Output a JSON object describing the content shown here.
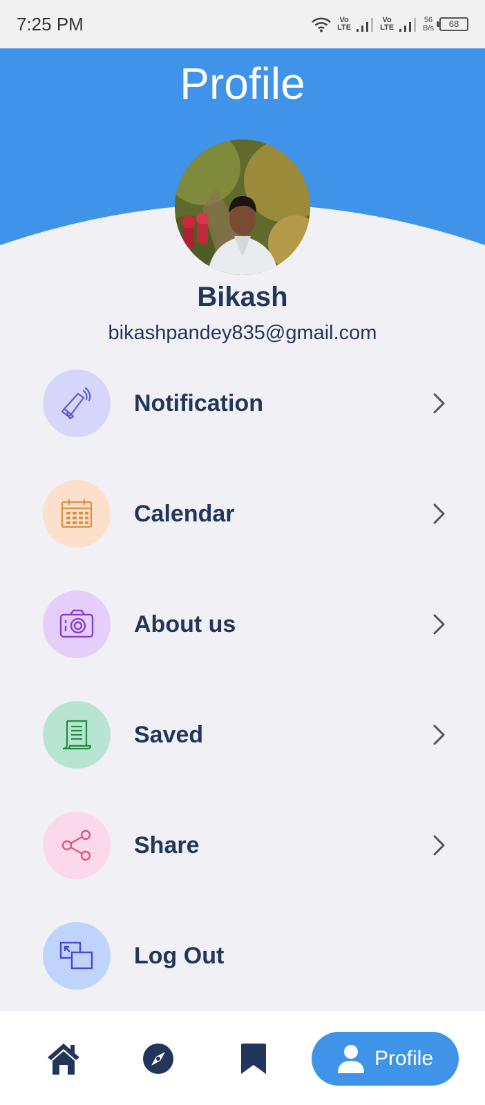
{
  "status_bar": {
    "time": "7:25 PM",
    "sim1": [
      "Vo",
      "LTE"
    ],
    "sim2": [
      "Vo",
      "LTE"
    ],
    "speed": [
      "56",
      "B/s"
    ],
    "battery": "68"
  },
  "header": {
    "title": "Profile",
    "color": "#3f93e8"
  },
  "user": {
    "name": "Bikash",
    "email": "bikashpandey835@gmail.com"
  },
  "menu": [
    {
      "label": "Notification",
      "icon": "megaphone-icon",
      "bg": "#d6d6fb",
      "stroke": "#5b5bd6",
      "has_chevron": true
    },
    {
      "label": "Calendar",
      "icon": "calendar-icon",
      "bg": "#fde0cb",
      "stroke": "#d99043",
      "has_chevron": true
    },
    {
      "label": "About us",
      "icon": "camera-icon",
      "bg": "#e5cef9",
      "stroke": "#8a3ed0",
      "has_chevron": true
    },
    {
      "label": "Saved",
      "icon": "scroll-icon",
      "bg": "#b8e5d2",
      "stroke": "#1f8d3e",
      "has_chevron": true
    },
    {
      "label": "Share",
      "icon": "share-icon",
      "bg": "#fcd9ea",
      "stroke": "#e0557f",
      "has_chevron": true
    },
    {
      "label": "Log Out",
      "icon": "logout-icon",
      "bg": "#bfd4fb",
      "stroke": "#4a47d6",
      "has_chevron": false
    }
  ],
  "bottom_nav": {
    "items": [
      {
        "icon": "home-icon"
      },
      {
        "icon": "compass-icon"
      },
      {
        "icon": "bookmark-icon"
      }
    ],
    "active": {
      "label": "Profile",
      "icon": "person-icon"
    },
    "icon_color": "#22355a"
  }
}
